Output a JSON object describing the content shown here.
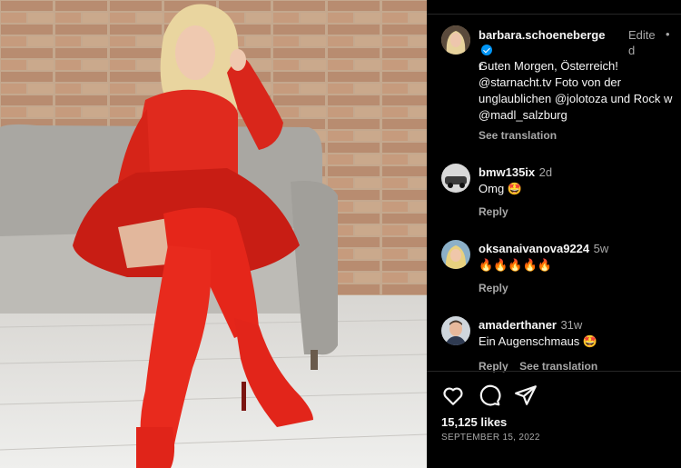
{
  "post": {
    "author": "barbara.schoeneberger",
    "author_line1": "barbara.schoeneberge",
    "author_line2": "r",
    "edited_label_line1": "Edite",
    "edited_label_line2": "d",
    "dot": "•",
    "caption_lines": [
      "Guten Morgen, Österreich!",
      "@starnacht.tv Foto von der",
      "unglaublichen @jolotoza und Rock w",
      "@madl_salzburg"
    ],
    "see_translation": "See translation"
  },
  "comments": [
    {
      "user": "bmw135ix",
      "time": "2d",
      "text": "Omg",
      "emoji": "🤩",
      "reply": "Reply",
      "see_translation": ""
    },
    {
      "user": "oksanaivanova9224",
      "time": "5w",
      "text": "",
      "emoji": "🔥🔥🔥🔥🔥",
      "reply": "Reply",
      "see_translation": ""
    },
    {
      "user": "amaderthaner",
      "time": "31w",
      "text": "Ein Augenschmaus",
      "emoji": "🤩",
      "reply": "Reply",
      "see_translation": "See translation"
    }
  ],
  "footer": {
    "likes": "15,125 likes",
    "date": "SEPTEMBER 15, 2022"
  },
  "colors": {
    "background": "#000000",
    "verified": "#0095f6",
    "muted": "#a8a8a8"
  },
  "icons": [
    "heart-icon",
    "comment-icon",
    "share-icon",
    "verified-icon"
  ]
}
